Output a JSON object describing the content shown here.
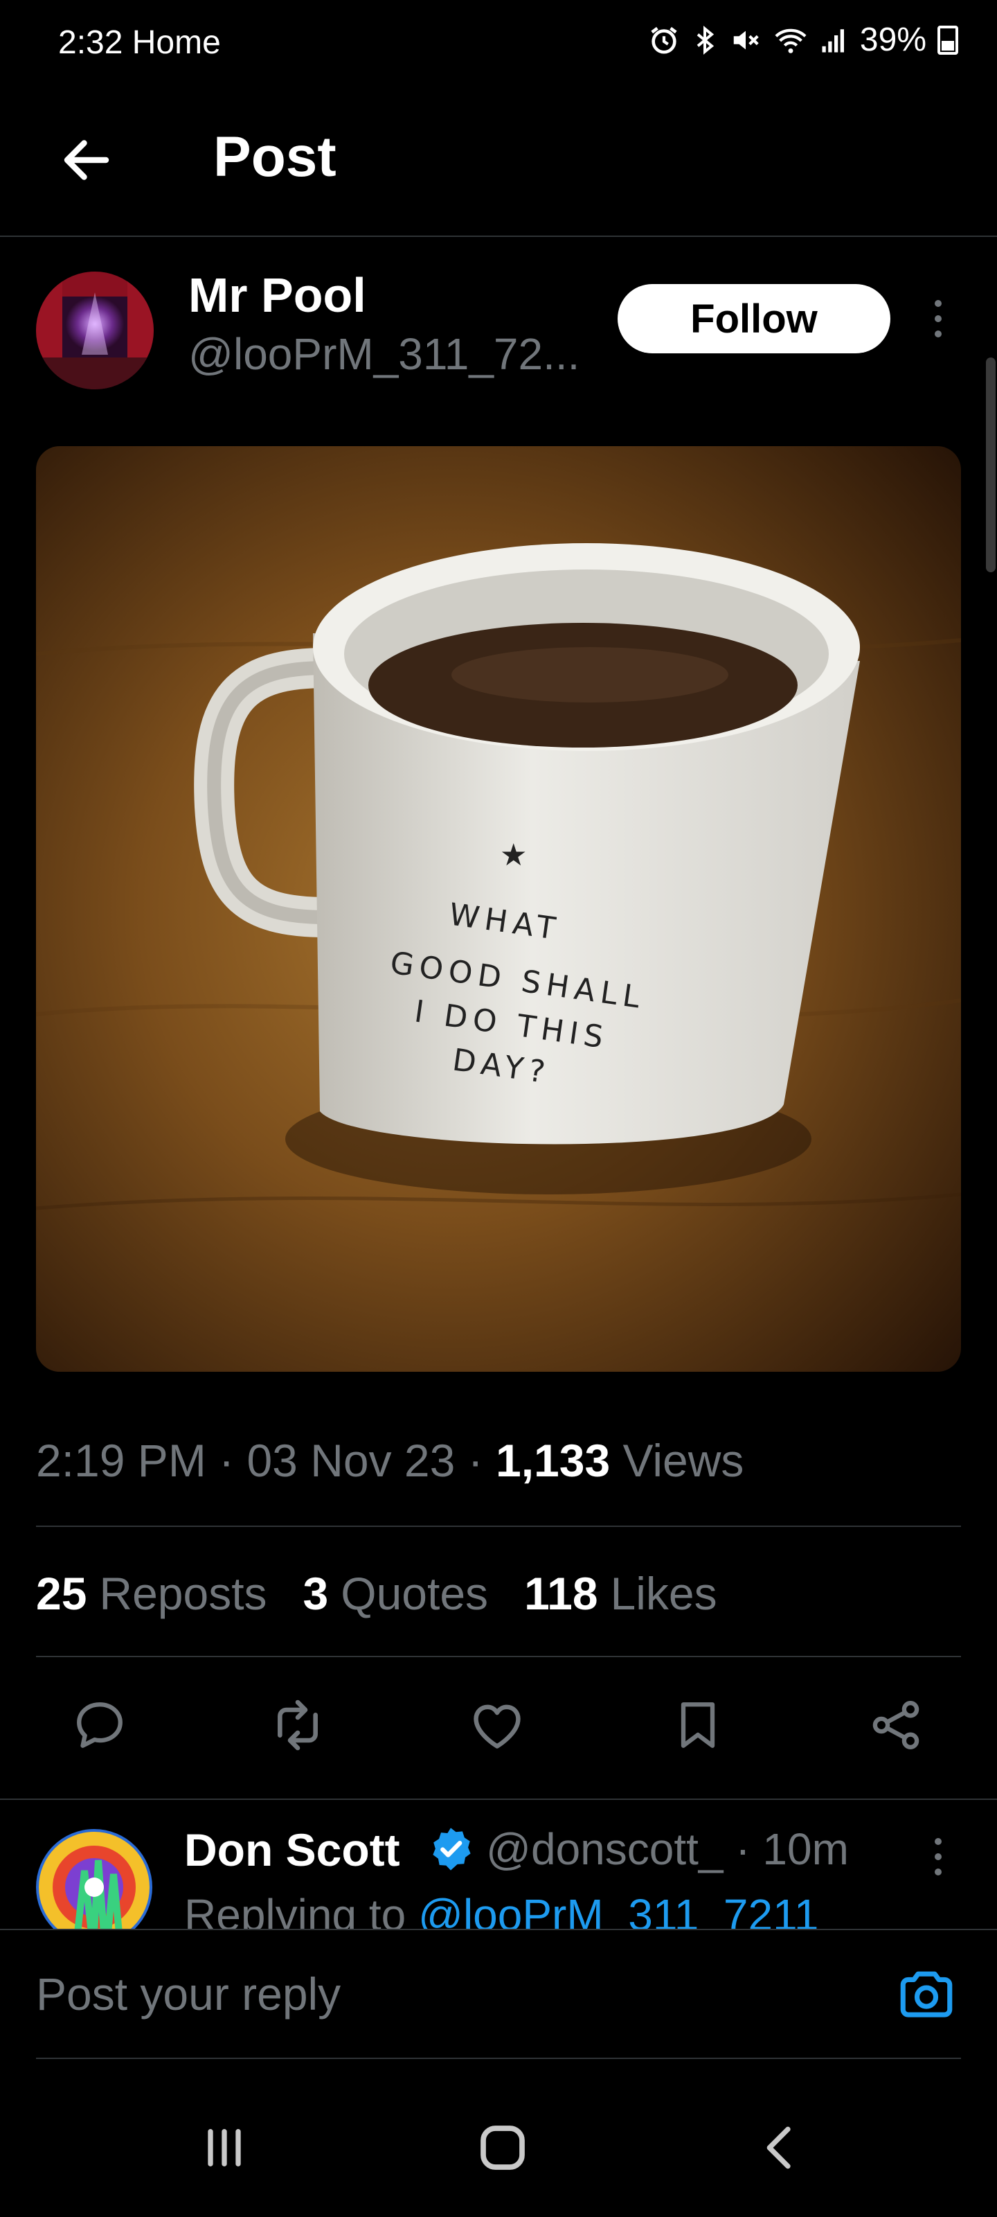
{
  "status_bar": {
    "time": "2:32",
    "app": "Home",
    "battery": "39%",
    "battery_level": 0.39
  },
  "header": {
    "title": "Post"
  },
  "author": {
    "name": "Mr Pool",
    "handle": "@looPrM_311_72...",
    "follow_label": "Follow"
  },
  "post": {
    "image_text": [
      "WHAT",
      "GOOD SHALL",
      "I DO THIS",
      "DAY?"
    ],
    "time": "2:19 PM",
    "date": "03 Nov 23",
    "views_count": "1,133",
    "views_label": "Views",
    "sep": "·"
  },
  "stats": {
    "reposts": {
      "count": "25",
      "label": "Reposts"
    },
    "quotes": {
      "count": "3",
      "label": "Quotes"
    },
    "likes": {
      "count": "118",
      "label": "Likes"
    }
  },
  "actions": [
    "reply-icon",
    "repost-icon",
    "like-icon",
    "bookmark-icon",
    "share-icon"
  ],
  "reply": {
    "name": "Don Scott",
    "handle": "@donscott_",
    "time": "10m",
    "replying_prefix": "Replying to",
    "replying_to": "@looPrM_311_7211"
  },
  "composer": {
    "placeholder": "Post your reply"
  },
  "colors": {
    "accent": "#1d9bf0",
    "muted": "#71767b",
    "divider": "#2f3336"
  }
}
